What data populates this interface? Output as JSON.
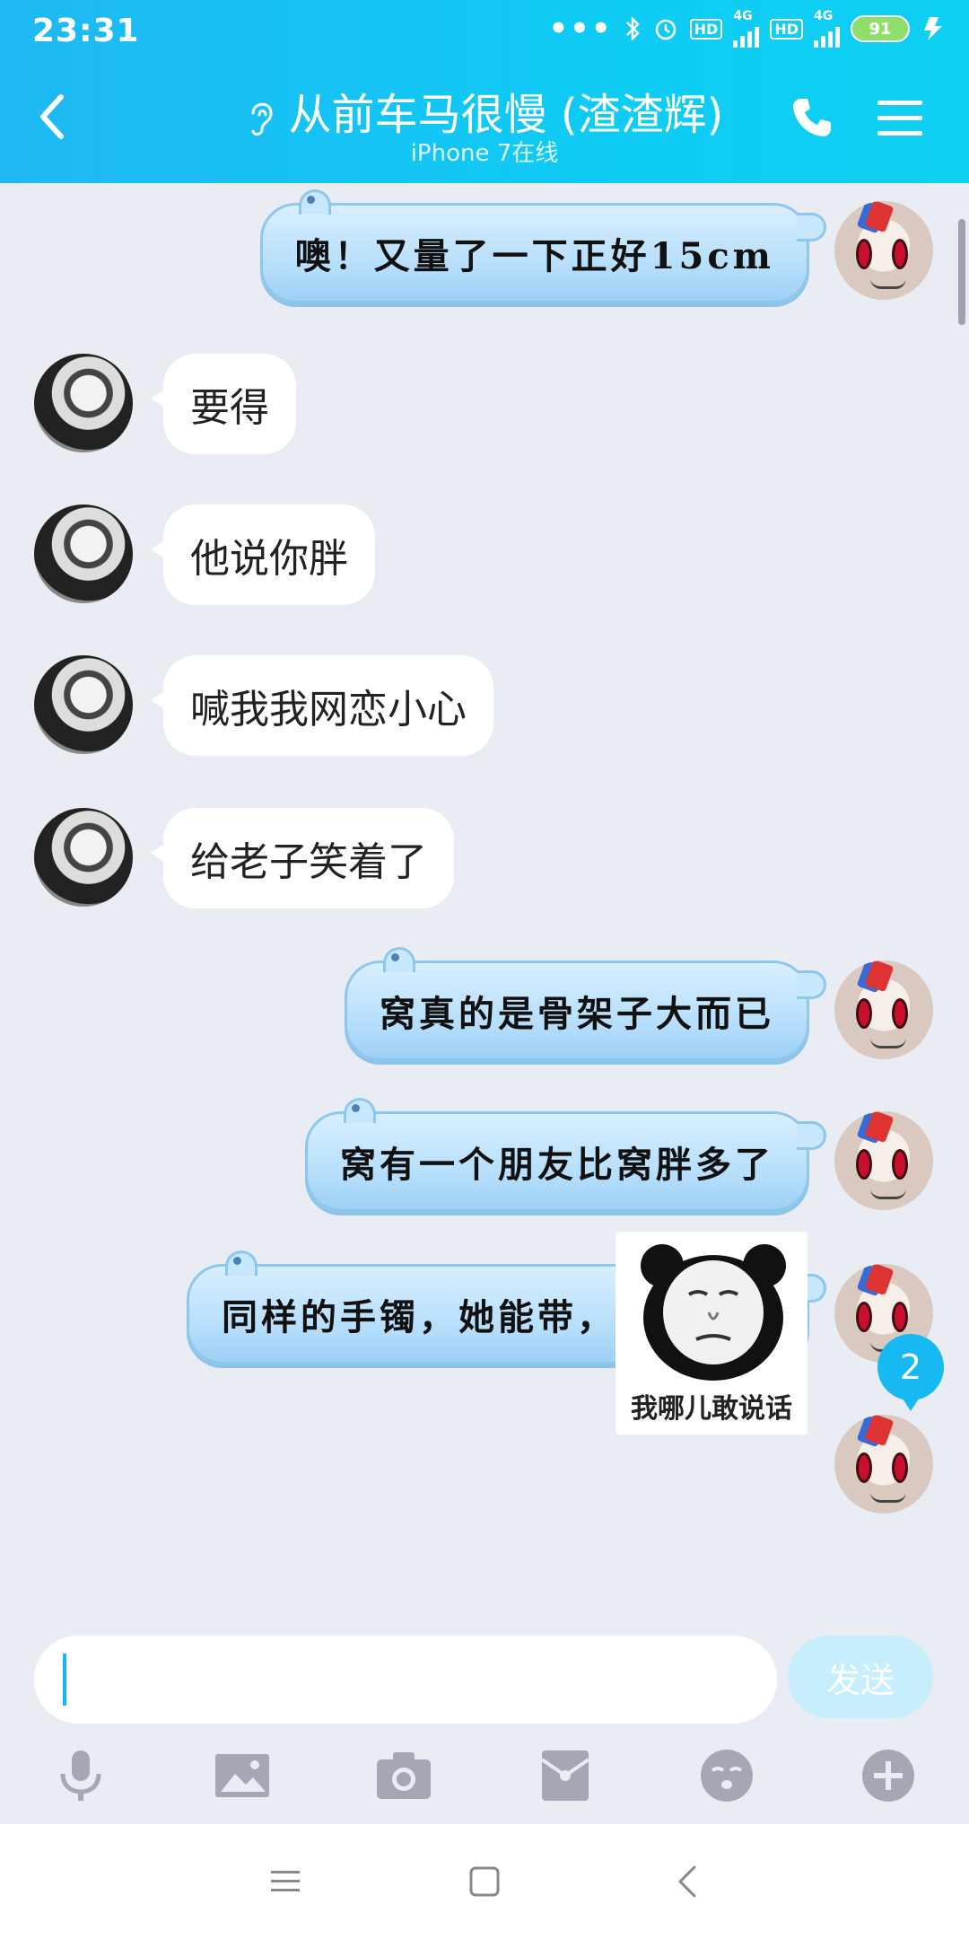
{
  "status": {
    "time": "23:31",
    "net1": "4G",
    "net2": "4G",
    "hd": "HD",
    "battery": "91"
  },
  "header": {
    "title": "从前车马很慢 (渣渣辉)",
    "subtitle": "iPhone 7在线"
  },
  "messages": [
    {
      "side": "right",
      "text": "噢！又量了一下正好15cm"
    },
    {
      "side": "left",
      "text": "要得"
    },
    {
      "side": "left",
      "text": "他说你胖"
    },
    {
      "side": "left",
      "text": "喊我我网恋小心"
    },
    {
      "side": "left",
      "text": "给老子笑着了"
    },
    {
      "side": "right",
      "text": "窝真的是骨架子大而已"
    },
    {
      "side": "right",
      "text": "窝有一个朋友比窝胖多了"
    },
    {
      "side": "right",
      "text": "同样的手镯，她能带，窝不能带"
    }
  ],
  "sticker": {
    "caption": "我哪儿敢说话"
  },
  "unread_count": "2",
  "input": {
    "value": "",
    "send_label": "发送"
  },
  "toolbar": {
    "icons": [
      "mic-icon",
      "image-icon",
      "camera-icon",
      "red-packet-icon",
      "emoji-icon",
      "plus-icon"
    ]
  },
  "colors": {
    "header": "#1ec0f4",
    "accent": "#17b9f2",
    "background": "#eaecf3"
  }
}
